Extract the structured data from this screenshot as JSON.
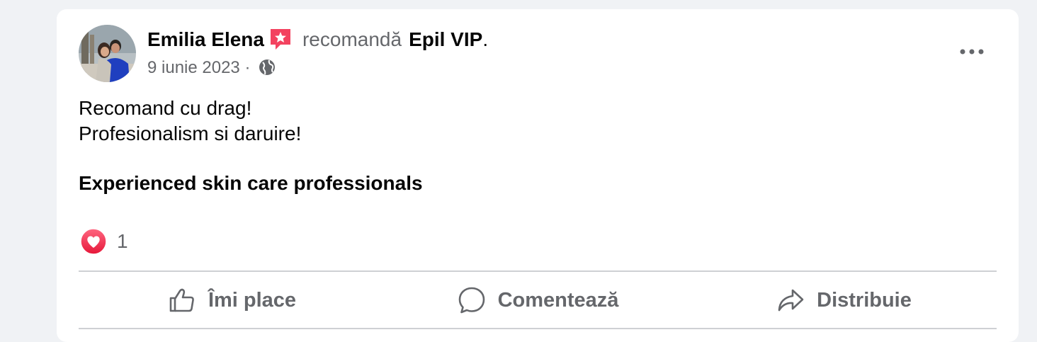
{
  "post": {
    "author": "Emilia Elena",
    "recommend_word": "recomandă",
    "page_name": "Epil VIP",
    "page_suffix": ".",
    "date": "9 iunie 2023",
    "separator": "·",
    "privacy_icon": "globe-icon",
    "text_lines": [
      "Recomand cu drag!",
      "Profesionalism si daruire!"
    ],
    "highlight": "Experienced skin care professionals",
    "reaction_icon": "love-reaction-icon",
    "reaction_count": "1"
  },
  "actions": {
    "like_label": "Îmi place",
    "comment_label": "Comentează",
    "share_label": "Distribuie"
  },
  "colors": {
    "text_primary": "#050505",
    "text_secondary": "#65676b",
    "divider": "#ced0d4",
    "recommend_badge": "#f3425f",
    "background": "#f0f2f5"
  }
}
